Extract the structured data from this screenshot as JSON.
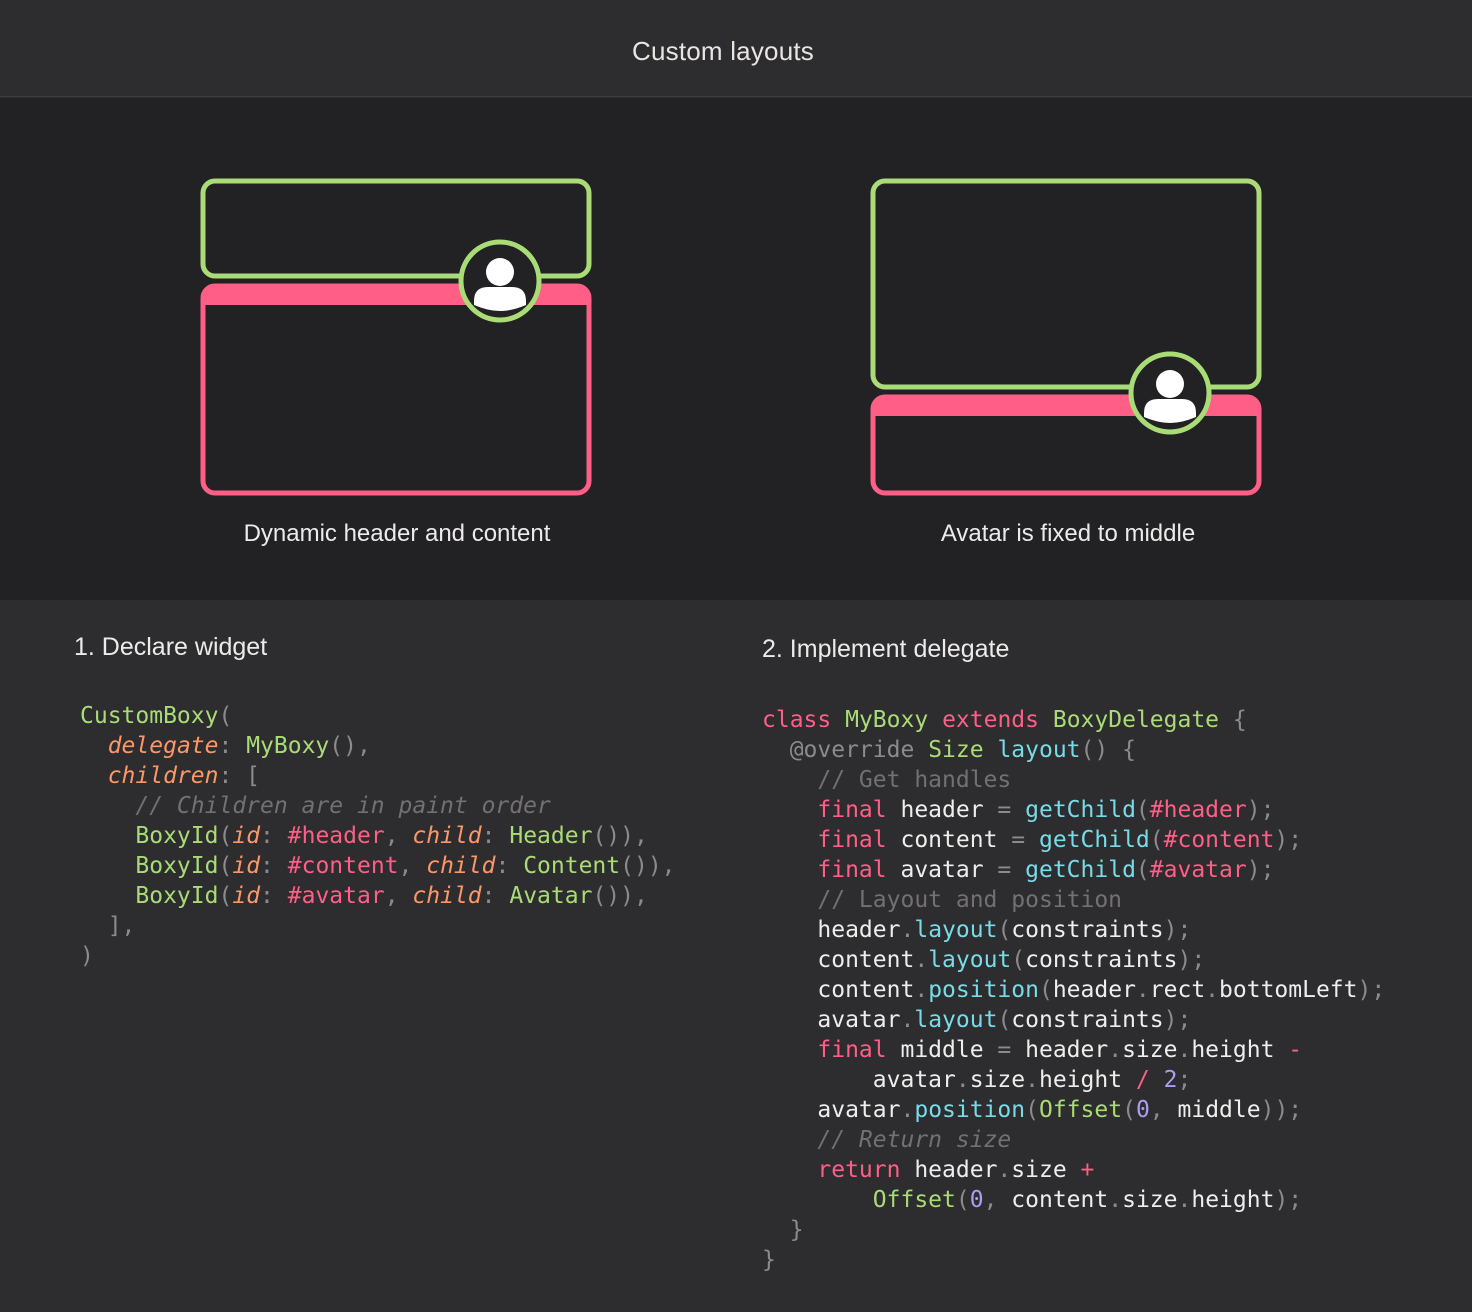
{
  "title": "Custom layouts",
  "colors": {
    "green": "#a9dc76",
    "pink": "#ff5f86",
    "diagram_bg": "#222124",
    "page_bg": "#2d2c2e"
  },
  "diagrams": [
    {
      "caption": "Dynamic header and content"
    },
    {
      "caption": "Avatar is fixed to middle"
    }
  ],
  "icons": {
    "avatar": "person-icon"
  },
  "steps": [
    {
      "heading": "1. Declare widget",
      "code": [
        [
          [
            "cls",
            "CustomBoxy"
          ],
          [
            "punc",
            "("
          ]
        ],
        [
          [
            "var",
            "  "
          ],
          [
            "param",
            "delegate"
          ],
          [
            "punc",
            ": "
          ],
          [
            "cls",
            "MyBoxy"
          ],
          [
            "punc",
            "(),"
          ]
        ],
        [
          [
            "var",
            "  "
          ],
          [
            "param",
            "children"
          ],
          [
            "punc",
            ": ["
          ]
        ],
        [
          [
            "var",
            "    "
          ],
          [
            "cmt-i",
            "// Children are in paint order"
          ]
        ],
        [
          [
            "var",
            "    "
          ],
          [
            "cls",
            "BoxyId"
          ],
          [
            "punc",
            "("
          ],
          [
            "param",
            "id"
          ],
          [
            "punc",
            ": "
          ],
          [
            "sym",
            "#header"
          ],
          [
            "punc",
            ", "
          ],
          [
            "param",
            "child"
          ],
          [
            "punc",
            ": "
          ],
          [
            "cls",
            "Header"
          ],
          [
            "punc",
            "()),"
          ]
        ],
        [
          [
            "var",
            "    "
          ],
          [
            "cls",
            "BoxyId"
          ],
          [
            "punc",
            "("
          ],
          [
            "param",
            "id"
          ],
          [
            "punc",
            ": "
          ],
          [
            "sym",
            "#content"
          ],
          [
            "punc",
            ", "
          ],
          [
            "param",
            "child"
          ],
          [
            "punc",
            ": "
          ],
          [
            "cls",
            "Content"
          ],
          [
            "punc",
            "()),"
          ]
        ],
        [
          [
            "var",
            "    "
          ],
          [
            "cls",
            "BoxyId"
          ],
          [
            "punc",
            "("
          ],
          [
            "param",
            "id"
          ],
          [
            "punc",
            ": "
          ],
          [
            "sym",
            "#avatar"
          ],
          [
            "punc",
            ", "
          ],
          [
            "param",
            "child"
          ],
          [
            "punc",
            ": "
          ],
          [
            "cls",
            "Avatar"
          ],
          [
            "punc",
            "()),"
          ]
        ],
        [
          [
            "var",
            "  "
          ],
          [
            "punc",
            "],"
          ]
        ],
        [
          [
            "punc",
            ")"
          ]
        ]
      ]
    },
    {
      "heading": "2. Implement delegate",
      "code": [
        [
          [
            "kw",
            "class"
          ],
          [
            "var",
            " "
          ],
          [
            "cls",
            "MyBoxy"
          ],
          [
            "var",
            " "
          ],
          [
            "kw",
            "extends"
          ],
          [
            "var",
            " "
          ],
          [
            "cls",
            "BoxyDelegate"
          ],
          [
            "var",
            " "
          ],
          [
            "punc",
            "{"
          ]
        ],
        [
          [
            "var",
            "  "
          ],
          [
            "punc",
            "@override"
          ],
          [
            "var",
            " "
          ],
          [
            "cls",
            "Size"
          ],
          [
            "var",
            " "
          ],
          [
            "fn",
            "layout"
          ],
          [
            "punc",
            "() {"
          ]
        ],
        [
          [
            "var",
            "    "
          ],
          [
            "cmt",
            "// Get handles"
          ]
        ],
        [
          [
            "var",
            "    "
          ],
          [
            "kw",
            "final"
          ],
          [
            "var",
            " header "
          ],
          [
            "op",
            "="
          ],
          [
            "var",
            " "
          ],
          [
            "fn",
            "getChild"
          ],
          [
            "punc",
            "("
          ],
          [
            "sym",
            "#header"
          ],
          [
            "punc",
            ");"
          ]
        ],
        [
          [
            "var",
            "    "
          ],
          [
            "kw",
            "final"
          ],
          [
            "var",
            " content "
          ],
          [
            "op",
            "="
          ],
          [
            "var",
            " "
          ],
          [
            "fn",
            "getChild"
          ],
          [
            "punc",
            "("
          ],
          [
            "sym",
            "#content"
          ],
          [
            "punc",
            ");"
          ]
        ],
        [
          [
            "var",
            "    "
          ],
          [
            "kw",
            "final"
          ],
          [
            "var",
            " avatar "
          ],
          [
            "op",
            "="
          ],
          [
            "var",
            " "
          ],
          [
            "fn",
            "getChild"
          ],
          [
            "punc",
            "("
          ],
          [
            "sym",
            "#avatar"
          ],
          [
            "punc",
            ");"
          ]
        ],
        [
          [
            "var",
            "    "
          ],
          [
            "cmt",
            "// Layout and position"
          ]
        ],
        [
          [
            "var",
            "    header"
          ],
          [
            "punc",
            "."
          ],
          [
            "fn",
            "layout"
          ],
          [
            "punc",
            "("
          ],
          [
            "var",
            "constraints"
          ],
          [
            "punc",
            ");"
          ]
        ],
        [
          [
            "var",
            "    content"
          ],
          [
            "punc",
            "."
          ],
          [
            "fn",
            "layout"
          ],
          [
            "punc",
            "("
          ],
          [
            "var",
            "constraints"
          ],
          [
            "punc",
            ");"
          ]
        ],
        [
          [
            "var",
            "    content"
          ],
          [
            "punc",
            "."
          ],
          [
            "fn",
            "position"
          ],
          [
            "punc",
            "("
          ],
          [
            "var",
            "header"
          ],
          [
            "punc",
            "."
          ],
          [
            "var",
            "rect"
          ],
          [
            "punc",
            "."
          ],
          [
            "var",
            "bottomLeft"
          ],
          [
            "punc",
            ");"
          ]
        ],
        [
          [
            "var",
            "    avatar"
          ],
          [
            "punc",
            "."
          ],
          [
            "fn",
            "layout"
          ],
          [
            "punc",
            "("
          ],
          [
            "var",
            "constraints"
          ],
          [
            "punc",
            ");"
          ]
        ],
        [
          [
            "var",
            "    "
          ],
          [
            "kw",
            "final"
          ],
          [
            "var",
            " middle "
          ],
          [
            "op",
            "="
          ],
          [
            "var",
            " header"
          ],
          [
            "punc",
            "."
          ],
          [
            "var",
            "size"
          ],
          [
            "punc",
            "."
          ],
          [
            "var",
            "height "
          ],
          [
            "opk",
            "-"
          ]
        ],
        [
          [
            "var",
            "        avatar"
          ],
          [
            "punc",
            "."
          ],
          [
            "var",
            "size"
          ],
          [
            "punc",
            "."
          ],
          [
            "var",
            "height "
          ],
          [
            "opk",
            "/"
          ],
          [
            "var",
            " "
          ],
          [
            "num",
            "2"
          ],
          [
            "punc",
            ";"
          ]
        ],
        [
          [
            "var",
            "    avatar"
          ],
          [
            "punc",
            "."
          ],
          [
            "fn",
            "position"
          ],
          [
            "punc",
            "("
          ],
          [
            "cls",
            "Offset"
          ],
          [
            "punc",
            "("
          ],
          [
            "num",
            "0"
          ],
          [
            "punc",
            ", "
          ],
          [
            "var",
            "middle"
          ],
          [
            "punc",
            "));"
          ]
        ],
        [
          [
            "var",
            "    "
          ],
          [
            "cmt-i",
            "// Return size"
          ]
        ],
        [
          [
            "var",
            "    "
          ],
          [
            "kw",
            "return"
          ],
          [
            "var",
            " header"
          ],
          [
            "punc",
            "."
          ],
          [
            "var",
            "size "
          ],
          [
            "opk",
            "+"
          ]
        ],
        [
          [
            "var",
            "        "
          ],
          [
            "cls",
            "Offset"
          ],
          [
            "punc",
            "("
          ],
          [
            "num",
            "0"
          ],
          [
            "punc",
            ", "
          ],
          [
            "var",
            "content"
          ],
          [
            "punc",
            "."
          ],
          [
            "var",
            "size"
          ],
          [
            "punc",
            "."
          ],
          [
            "var",
            "height"
          ],
          [
            "punc",
            ");"
          ]
        ],
        [
          [
            "var",
            "  "
          ],
          [
            "punc",
            "}"
          ]
        ],
        [
          [
            "punc",
            "}"
          ]
        ]
      ]
    }
  ]
}
